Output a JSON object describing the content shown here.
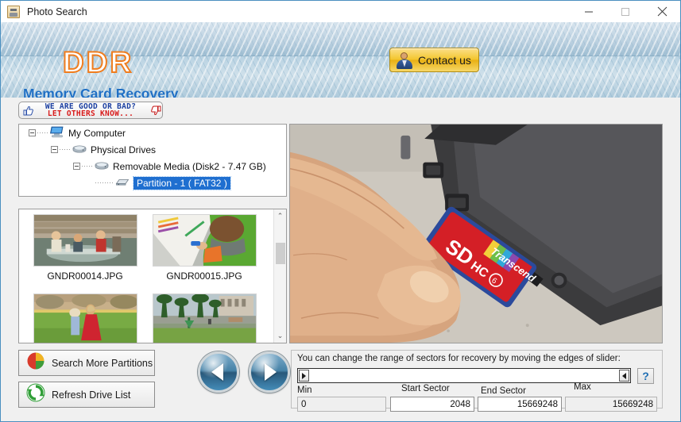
{
  "window": {
    "title": "Photo Search",
    "icon": "photo-search-icon",
    "minimize": "—",
    "maximize": "□",
    "close": "✕"
  },
  "banner": {
    "logo": "DDR",
    "subtitle": "Memory Card Recovery",
    "contact_label": "Contact us"
  },
  "review_badge": {
    "line1": "WE ARE GOOD OR BAD?",
    "line2": "LET OTHERS KNOW...",
    "line1_color": "#1b3fa0",
    "line2_color": "#d81a1a"
  },
  "tree": {
    "nodes": [
      {
        "label": "My Computer",
        "icon": "computer-icon",
        "depth": 0,
        "expanded": true,
        "selected": false
      },
      {
        "label": "Physical Drives",
        "icon": "drive-icon",
        "depth": 1,
        "expanded": true,
        "selected": false
      },
      {
        "label": "Removable Media (Disk2 - 7.47 GB)",
        "icon": "drive-icon",
        "depth": 2,
        "expanded": true,
        "selected": false
      },
      {
        "label": "Partition - 1 ( FAT32 )",
        "icon": "partition-icon",
        "depth": 3,
        "expanded": false,
        "selected": true
      }
    ]
  },
  "thumbnails": {
    "items": [
      {
        "name": "GNDR00014.JPG",
        "art": "picnic"
      },
      {
        "name": "GNDR00015.JPG",
        "art": "child-drawing"
      },
      {
        "name": "",
        "art": "kids-field"
      },
      {
        "name": "",
        "art": "palm-plaza"
      }
    ],
    "scrollbar": {
      "up": "⌃",
      "down": "⌄"
    }
  },
  "actions": {
    "search_more_partitions": "Search More Partitions",
    "refresh_drive_list": "Refresh Drive List",
    "prev": "previous-image",
    "next": "next-image"
  },
  "preview": {
    "description": "memory-card-insert-photo"
  },
  "sectors": {
    "hint": "You can change the range of sectors for recovery by moving the edges of slider:",
    "help": "?",
    "min_label": "Min",
    "min_value": "0",
    "start_label": "Start Sector",
    "start_value": "2048",
    "end_label": "End Sector",
    "end_value": "15669248",
    "max_label": "Max",
    "max_value": "15669248"
  },
  "colors": {
    "accent_blue": "#1f6fc4",
    "logo_orange": "#f07d1e",
    "selection_blue": "#1f6fd0",
    "contact_gold": "#f3c52d"
  }
}
